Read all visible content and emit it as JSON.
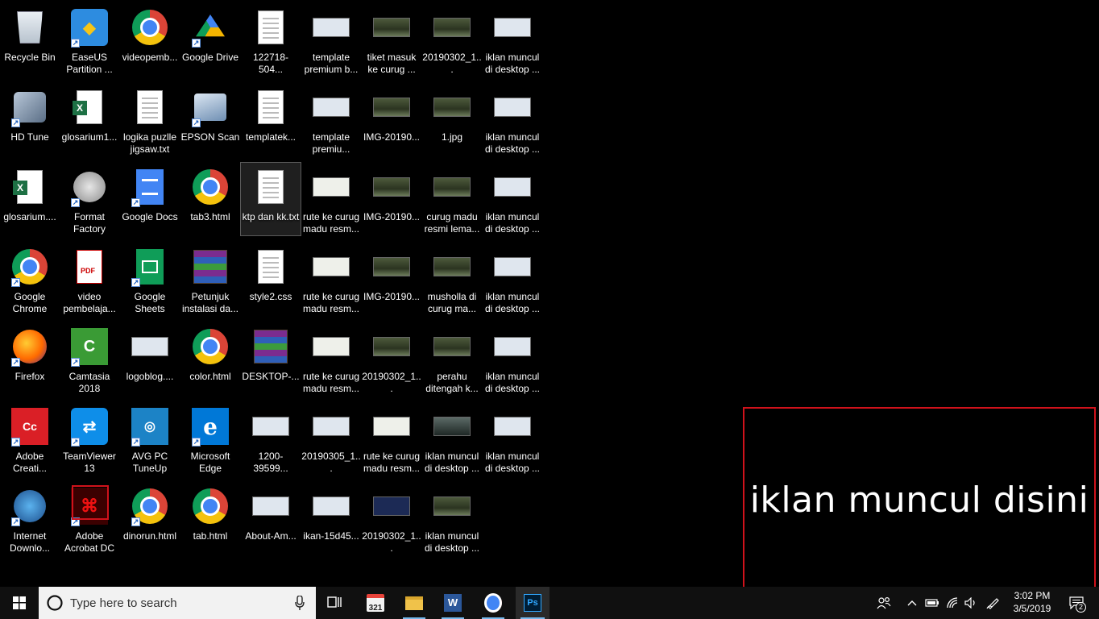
{
  "desktop": {
    "icons": [
      {
        "label": "Recycle Bin",
        "glyph": "recycle-bin-icon"
      },
      {
        "label": "EaseUS Partition ...",
        "glyph": "easeus-icon"
      },
      {
        "label": "videopemb...",
        "glyph": "chrome-icon"
      },
      {
        "label": "Google Drive",
        "glyph": "google-drive-icon"
      },
      {
        "label": "122718-504...",
        "glyph": "notepad-icon"
      },
      {
        "label": "template premium b...",
        "glyph": "image-thumbnail-icon"
      },
      {
        "label": "tiket masuk ke curug ...",
        "glyph": "image-thumbnail-icon"
      },
      {
        "label": "20190302_1...",
        "glyph": "image-thumbnail-icon"
      },
      {
        "label": "iklan muncul di desktop ...",
        "glyph": "image-thumbnail-icon"
      },
      {
        "label": "HD Tune",
        "glyph": "hd-tune-icon"
      },
      {
        "label": "glosarium1...",
        "glyph": "excel-file-icon"
      },
      {
        "label": "logika puzlle jigsaw.txt",
        "glyph": "text-file-icon"
      },
      {
        "label": "EPSON Scan",
        "glyph": "scanner-icon"
      },
      {
        "label": "templatek...",
        "glyph": "text-file-icon"
      },
      {
        "label": "template premiu...",
        "glyph": "image-thumbnail-icon"
      },
      {
        "label": "IMG-20190...",
        "glyph": "image-thumbnail-icon"
      },
      {
        "label": "1.jpg",
        "glyph": "image-thumbnail-icon"
      },
      {
        "label": "iklan muncul di desktop ...",
        "glyph": "image-thumbnail-icon"
      },
      {
        "label": "glosarium....",
        "glyph": "excel-file-icon"
      },
      {
        "label": "Format Factory",
        "glyph": "format-factory-icon"
      },
      {
        "label": "Google Docs",
        "glyph": "google-docs-icon"
      },
      {
        "label": "tab3.html",
        "glyph": "chrome-icon"
      },
      {
        "label": "ktp dan kk.txt",
        "glyph": "text-file-icon"
      },
      {
        "label": "rute ke curug madu resm...",
        "glyph": "image-thumbnail-icon"
      },
      {
        "label": "IMG-20190...",
        "glyph": "image-thumbnail-icon"
      },
      {
        "label": "curug madu resmi lema...",
        "glyph": "image-thumbnail-icon"
      },
      {
        "label": "iklan muncul di desktop ...",
        "glyph": "image-thumbnail-icon"
      },
      {
        "label": "Google Chrome",
        "glyph": "chrome-icon"
      },
      {
        "label": "video pembelaja...",
        "glyph": "pdf-icon"
      },
      {
        "label": "Google Sheets",
        "glyph": "google-sheets-icon"
      },
      {
        "label": "Petunjuk instalasi da...",
        "glyph": "winrar-icon"
      },
      {
        "label": "style2.css",
        "glyph": "css-file-icon"
      },
      {
        "label": "rute ke curug madu resm...",
        "glyph": "image-thumbnail-icon"
      },
      {
        "label": "IMG-20190...",
        "glyph": "image-thumbnail-icon"
      },
      {
        "label": "musholla di curug ma...",
        "glyph": "image-thumbnail-icon"
      },
      {
        "label": "iklan muncul di desktop ...",
        "glyph": "image-thumbnail-icon"
      },
      {
        "label": "Firefox",
        "glyph": "firefox-icon"
      },
      {
        "label": "Camtasia 2018",
        "glyph": "camtasia-icon"
      },
      {
        "label": "logoblog....",
        "glyph": "image-thumbnail-icon"
      },
      {
        "label": "color.html",
        "glyph": "chrome-icon"
      },
      {
        "label": "DESKTOP-...",
        "glyph": "winrar-icon"
      },
      {
        "label": "rute ke curug madu resm...",
        "glyph": "image-thumbnail-icon"
      },
      {
        "label": "20190302_1...",
        "glyph": "image-thumbnail-icon"
      },
      {
        "label": "perahu ditengah k...",
        "glyph": "image-thumbnail-icon"
      },
      {
        "label": "iklan muncul di desktop ...",
        "glyph": "image-thumbnail-icon"
      },
      {
        "label": "Adobe Creati...",
        "glyph": "adobe-cc-icon"
      },
      {
        "label": "TeamViewer 13",
        "glyph": "teamviewer-icon"
      },
      {
        "label": "AVG PC TuneUp",
        "glyph": "avg-icon"
      },
      {
        "label": "Microsoft Edge",
        "glyph": "edge-icon"
      },
      {
        "label": "1200-39599...",
        "glyph": "image-thumbnail-icon"
      },
      {
        "label": "20190305_1...",
        "glyph": "image-thumbnail-icon"
      },
      {
        "label": "rute ke curug madu resm...",
        "glyph": "image-thumbnail-icon"
      },
      {
        "label": "iklan muncul di desktop ...",
        "glyph": "image-thumbnail-icon"
      },
      {
        "label": "iklan muncul di desktop ...",
        "glyph": "image-thumbnail-icon"
      },
      {
        "label": "Internet Downlo...",
        "glyph": "idm-icon"
      },
      {
        "label": "Adobe Acrobat DC",
        "glyph": "acrobat-icon"
      },
      {
        "label": "dinorun.html",
        "glyph": "chrome-icon"
      },
      {
        "label": "tab.html",
        "glyph": "chrome-icon"
      },
      {
        "label": "About-Am...",
        "glyph": "image-thumbnail-icon"
      },
      {
        "label": "ikan-15d45...",
        "glyph": "image-thumbnail-icon"
      },
      {
        "label": "20190302_1...",
        "glyph": "image-thumbnail-icon"
      },
      {
        "label": "iklan muncul di desktop ...",
        "glyph": "image-thumbnail-icon"
      }
    ],
    "selected_label": "ktp dan kk.txt"
  },
  "ad_box": {
    "text": "iklan muncul disini",
    "border_color": "#d0121b"
  },
  "taskbar": {
    "search_placeholder": "Type here to search",
    "pinned": [
      "task-view-icon",
      "calendar-app-icon",
      "file-explorer-icon",
      "word-icon",
      "chrome-icon",
      "photoshop-icon"
    ],
    "tray_icons": [
      "people-icon",
      "chevron-up-icon",
      "battery-icon",
      "wifi-icon",
      "volume-icon",
      "pen-icon"
    ],
    "clock_time": "3:02 PM",
    "clock_date": "3/5/2019",
    "notification_count": "2"
  }
}
